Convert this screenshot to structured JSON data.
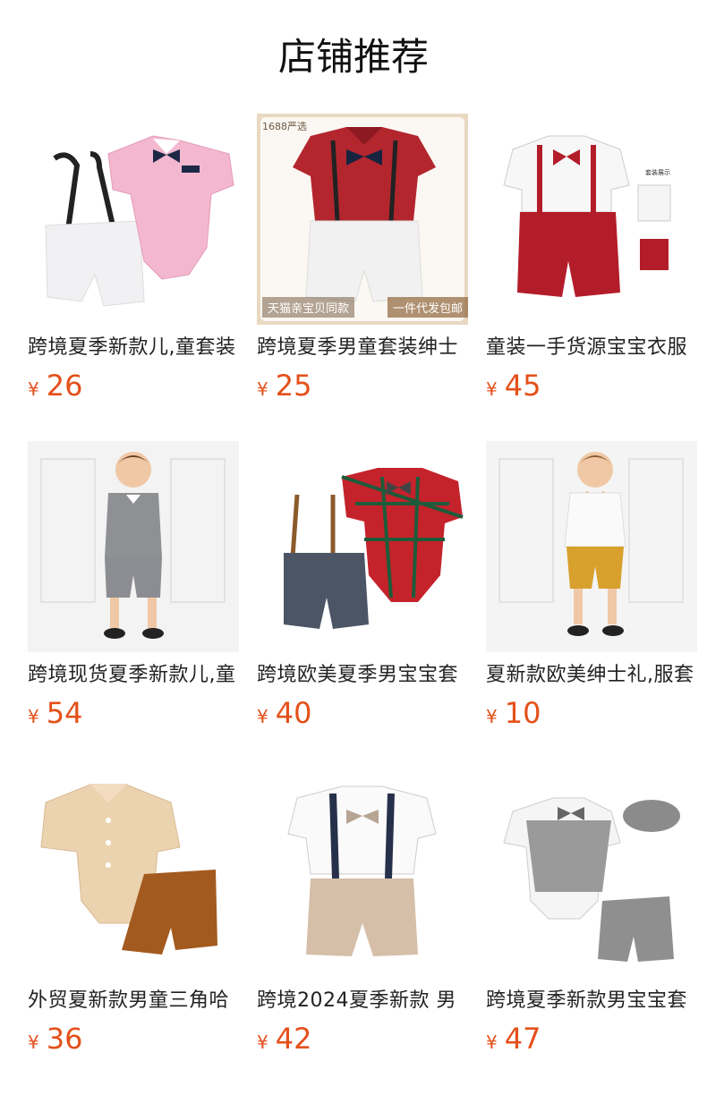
{
  "header": {
    "title": "店铺推荐"
  },
  "currency": "¥",
  "products": [
    {
      "name": "跨境夏季新款儿,童套装",
      "price": "26",
      "image": "pink-romper-suspenders"
    },
    {
      "name": "跨境夏季男童套装绅士",
      "price": "25",
      "image": "red-shirt-white-shorts",
      "badges": {
        "top_left": "1688严选",
        "bottom_left": "天猫亲宝贝同款",
        "bottom_right": "一件代发包邮"
      }
    },
    {
      "name": "童装一手货源宝宝衣服",
      "price": "45",
      "image": "white-shirt-red-shorts",
      "badges": {
        "inset": "套装展示"
      }
    },
    {
      "name": "跨境现货夏季新款儿,童",
      "price": "54",
      "image": "boy-grey-vest"
    },
    {
      "name": "跨境欧美夏季男宝宝套",
      "price": "40",
      "image": "plaid-romper-suspenders"
    },
    {
      "name": "夏新款欧美绅士礼,服套",
      "price": "10",
      "image": "boy-print-shirt-mustard-shorts"
    },
    {
      "name": "外贸夏新款男童三角哈",
      "price": "36",
      "image": "beige-romper-brown-shorts"
    },
    {
      "name": "跨境2024夏季新款 男",
      "price": "42",
      "image": "white-shirt-khaki-shorts"
    },
    {
      "name": "跨境夏季新款男宝宝套",
      "price": "47",
      "image": "grey-plaid-vest-cap"
    }
  ]
}
